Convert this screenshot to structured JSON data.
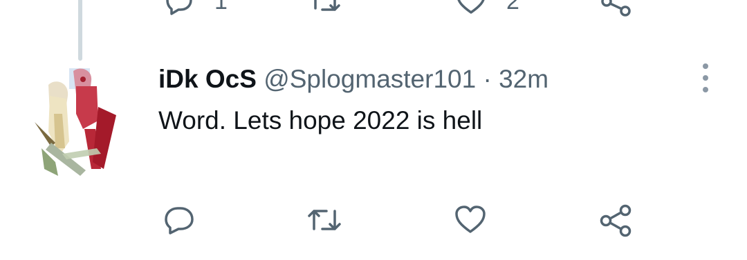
{
  "previous_tweet": {
    "reply_count": "1",
    "like_count": "2"
  },
  "tweet": {
    "display_name": "iDk OcS",
    "handle": "@Splogmaster101",
    "separator": "·",
    "time": "32m",
    "text": "Word. Lets hope 2022 is hell",
    "avatar": "anime-characters-avatar"
  },
  "actions": {
    "reply_icon": "reply-icon",
    "retweet_icon": "retweet-icon",
    "like_icon": "like-icon",
    "share_icon": "share-icon",
    "more_icon": "more-vertical-icon"
  },
  "colors": {
    "text_primary": "#0f1419",
    "text_secondary": "#536471",
    "thread_line": "#cfd9de"
  }
}
